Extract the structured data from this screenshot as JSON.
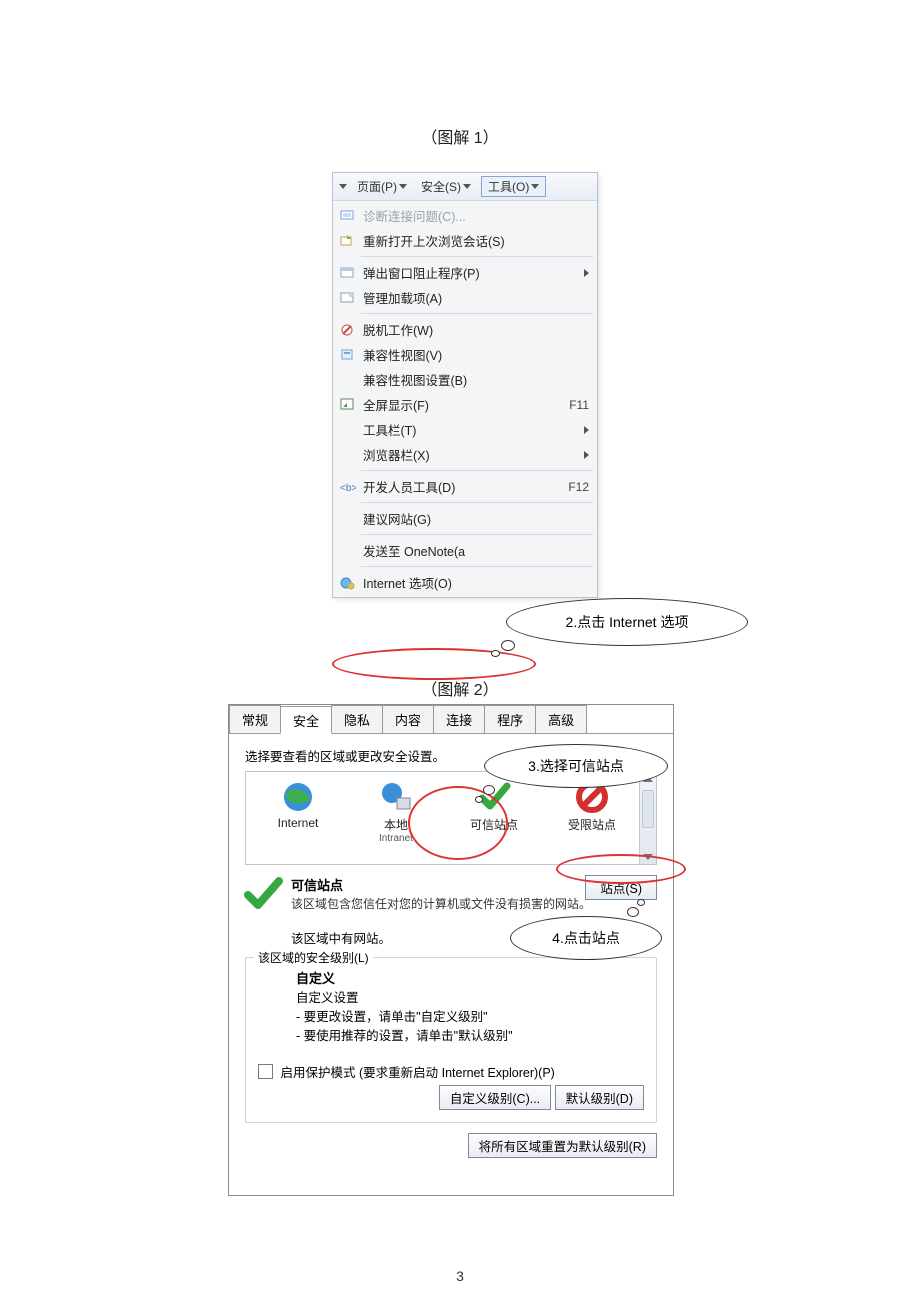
{
  "captions": {
    "fig1": "（图解 1）",
    "fig2": "（图解 2）"
  },
  "page_number": "3",
  "toolbar": {
    "page": "页面(P)",
    "safety": "安全(S)",
    "tools": "工具(O)"
  },
  "tools_menu": {
    "diagnose": "诊断连接问题(C)...",
    "reopen": "重新打开上次浏览会话(S)",
    "popup": "弹出窗口阻止程序(P)",
    "addons": "管理加载项(A)",
    "offline": "脱机工作(W)",
    "compat": "兼容性视图(V)",
    "compat_settings": "兼容性视图设置(B)",
    "fullscreen": "全屏显示(F)",
    "fullscreen_key": "F11",
    "toolbars": "工具栏(T)",
    "explorer_bars": "浏览器栏(X)",
    "devtools": "开发人员工具(D)",
    "devtools_key": "F12",
    "suggested": "建议网站(G)",
    "send_onenote": "发送至 OneNote(a",
    "internet_options": "Internet 选项(O)"
  },
  "callouts": {
    "c2": "2.点击 Internet 选项",
    "c3": "3.选择可信站点",
    "c4": "4.点击站点"
  },
  "options_dialog": {
    "tabs": {
      "general": "常规",
      "security": "安全",
      "privacy": "隐私",
      "content": "内容",
      "connections": "连接",
      "programs": "程序",
      "advanced": "高级"
    },
    "zone_instruction": "选择要查看的区域或更改安全设置。",
    "zones": {
      "internet": "Internet",
      "local": "本地",
      "local_sub": "Intranet",
      "trusted": "可信站点",
      "restricted": "受限站点"
    },
    "trusted": {
      "title": "可信站点",
      "desc": "该区域包含您信任对您的计算机或文件没有损害的网站。",
      "has_sites": "该区域中有网站。",
      "sites_button": "站点(S)"
    },
    "level": {
      "legend": "该区域的安全级别(L)",
      "custom": "自定义",
      "custom_sub": "自定义设置",
      "line1": "- 要更改设置，请单击\"自定义级别\"",
      "line2": "- 要使用推荐的设置，请单击\"默认级别\"",
      "protected": "启用保护模式 (要求重新启动 Internet Explorer)(P)",
      "custom_level_btn": "自定义级别(C)...",
      "default_level_btn": "默认级别(D)",
      "reset_btn": "将所有区域重置为默认级别(R)"
    }
  }
}
